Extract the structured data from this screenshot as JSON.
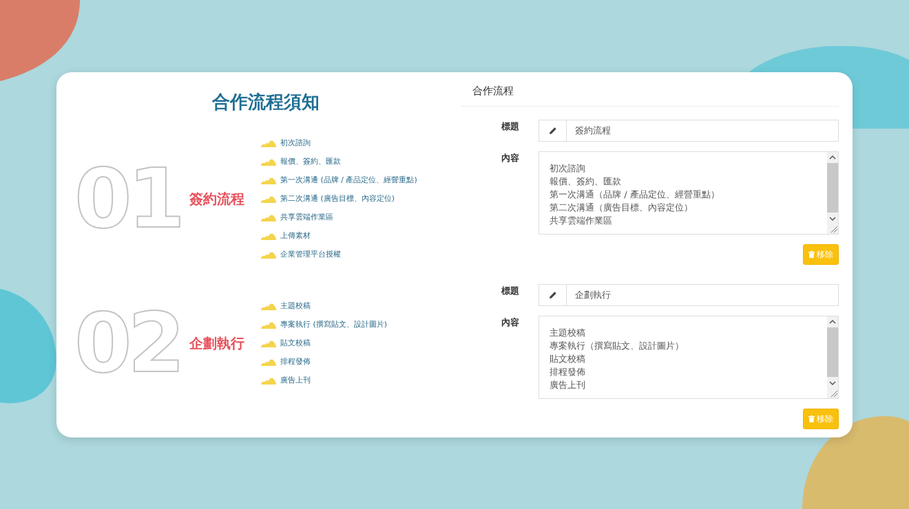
{
  "title": "合作流程須知",
  "sections": [
    {
      "number": "01",
      "name": "簽約流程",
      "steps": [
        "初次諮詢",
        "報價、簽約、匯款",
        "第一次溝通 (品牌 / 產品定位、經營重點)",
        "第二次溝通 (廣告目標、內容定位)",
        "共享雲端作業區",
        "上傳素材",
        "企業管理平台授權"
      ]
    },
    {
      "number": "02",
      "name": "企劃執行",
      "steps": [
        "主題校稿",
        "專案執行 (撰寫貼文、設計圖片)",
        "貼文校稿",
        "排程發佈",
        "廣告上刊"
      ]
    }
  ],
  "editor": {
    "header": "合作流程",
    "entries": [
      {
        "title_label": "標題",
        "title_value": "簽約流程",
        "content_label": "內容",
        "content_lines": [
          "初次諮詢",
          "報價、簽約、匯款",
          "第一次溝通（品牌 / 產品定位、經營重點）",
          "第二次溝通（廣告目標、內容定位）",
          "共享雲端作業區"
        ],
        "remove_button": "移除"
      },
      {
        "title_label": "標題",
        "title_value": "企劃執行",
        "content_label": "內容",
        "content_lines": [
          "主題校稿",
          "專案執行（撰寫貼文、設計圖片）",
          "貼文校稿",
          "排程發佈",
          "廣告上刊"
        ],
        "remove_button": "移除"
      }
    ]
  }
}
